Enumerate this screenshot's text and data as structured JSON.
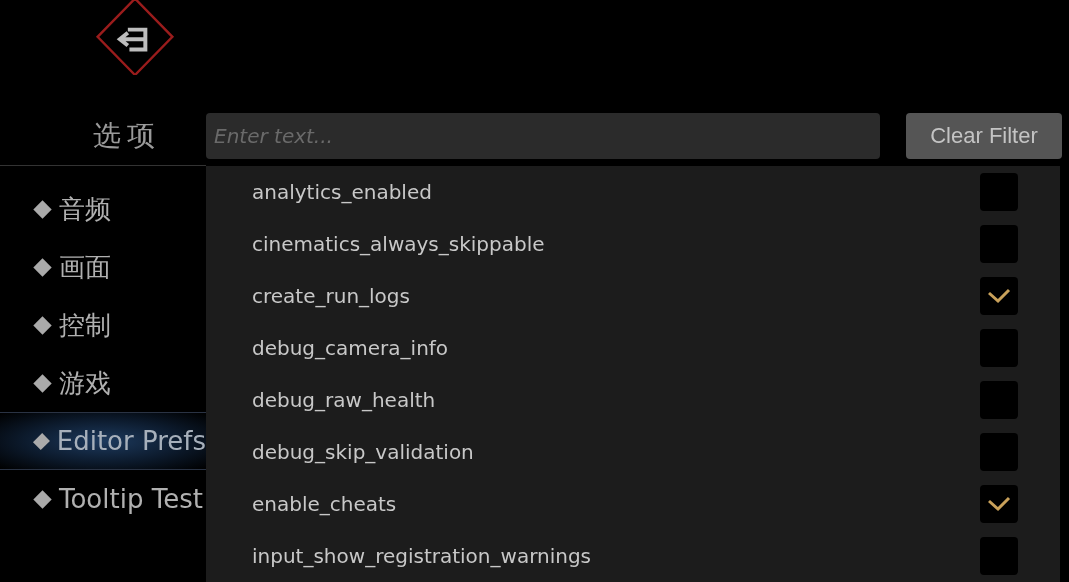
{
  "title": "选项",
  "filter": {
    "placeholder": "Enter text...",
    "button": "Clear Filter"
  },
  "sidebar": {
    "items": [
      {
        "label": "音频",
        "selected": false
      },
      {
        "label": "画面",
        "selected": false
      },
      {
        "label": "控制",
        "selected": false
      },
      {
        "label": "游戏",
        "selected": false
      },
      {
        "label": "Editor Prefs",
        "selected": true
      },
      {
        "label": "Tooltip Test",
        "selected": false
      }
    ]
  },
  "prefs": [
    {
      "name": "analytics_enabled",
      "checked": false
    },
    {
      "name": "cinematics_always_skippable",
      "checked": false
    },
    {
      "name": "create_run_logs",
      "checked": true
    },
    {
      "name": "debug_camera_info",
      "checked": false
    },
    {
      "name": "debug_raw_health",
      "checked": false
    },
    {
      "name": "debug_skip_validation",
      "checked": false
    },
    {
      "name": "enable_cheats",
      "checked": true
    },
    {
      "name": "input_show_registration_warnings",
      "checked": false
    }
  ]
}
